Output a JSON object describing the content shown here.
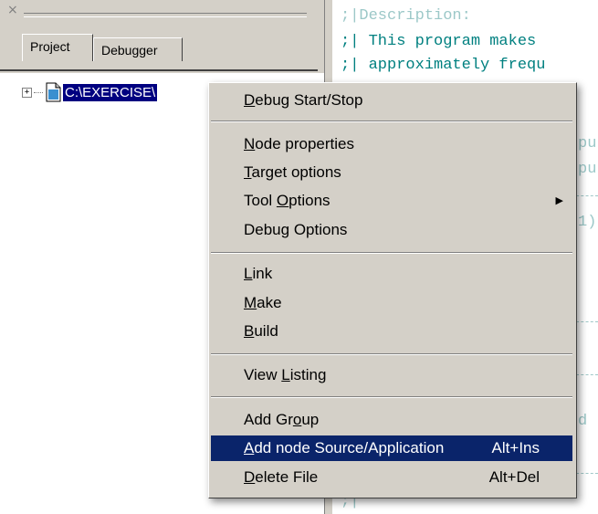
{
  "project_panel": {
    "tabs": [
      "Project",
      "Debugger"
    ],
    "tree_item_label": "C:\\EXERCISE\\"
  },
  "code_editor": {
    "lines": [
      ";|Description:",
      ";| This program makes",
      ";| approximately frequ"
    ],
    "fragments": [
      "pu",
      "pu",
      "1)",
      "d"
    ],
    "last_line": ";|"
  },
  "context_menu": {
    "items": [
      {
        "pre": "",
        "key": "D",
        "post": "ebug Start/Stop",
        "shortcut": ""
      },
      {
        "pre": "",
        "key": "N",
        "post": "ode properties",
        "shortcut": ""
      },
      {
        "pre": "",
        "key": "T",
        "post": "arget options",
        "shortcut": ""
      },
      {
        "pre": "Tool ",
        "key": "O",
        "post": "ptions",
        "shortcut": "",
        "submenu": "▶"
      },
      {
        "pre": "Debug Options",
        "key": "",
        "post": "",
        "shortcut": ""
      },
      {
        "pre": "",
        "key": "L",
        "post": "ink",
        "shortcut": ""
      },
      {
        "pre": "",
        "key": "M",
        "post": "ake",
        "shortcut": ""
      },
      {
        "pre": "",
        "key": "B",
        "post": "uild",
        "shortcut": ""
      },
      {
        "pre": "View ",
        "key": "L",
        "post": "isting",
        "shortcut": ""
      },
      {
        "pre": "Add Gr",
        "key": "o",
        "post": "up",
        "shortcut": ""
      },
      {
        "pre": "",
        "key": "A",
        "post": "dd node Source/Application",
        "shortcut": "Alt+Ins"
      },
      {
        "pre": "",
        "key": "D",
        "post": "elete File",
        "shortcut": "Alt+Del"
      }
    ],
    "highlighted_index": 10,
    "highlight_color": "#0a246a"
  }
}
